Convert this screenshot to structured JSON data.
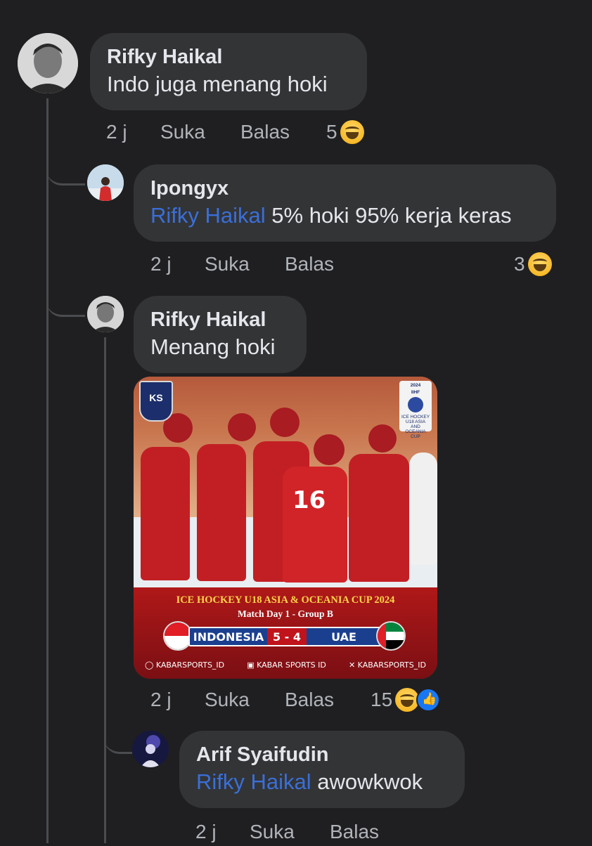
{
  "comments": [
    {
      "author": "Rifky Haikal",
      "text": "Indo juga menang hoki",
      "time": "2 j",
      "like_label": "Suka",
      "reply_label": "Balas",
      "reaction_count": "5",
      "reactions": [
        "laugh-emoji"
      ]
    },
    {
      "author": "Ipongyx",
      "mention": "Rifky Haikal",
      "text": "5% hoki 95% kerja keras",
      "time": "2 j",
      "like_label": "Suka",
      "reply_label": "Balas",
      "reaction_count": "3",
      "reactions": [
        "laugh-emoji"
      ]
    },
    {
      "author": "Rifky Haikal",
      "text": "Menang hoki",
      "time": "2 j",
      "like_label": "Suka",
      "reply_label": "Balas",
      "reaction_count": "15",
      "reactions": [
        "laugh-emoji",
        "like-emoji"
      ],
      "image": {
        "logo_left": "KS",
        "logo_right_year": "2024",
        "logo_right_org": "IIHF",
        "logo_right_text": "ICE HOCKEY U18 ASIA AND OCEANIA CUP",
        "jersey_number": "16",
        "headline": "ICE HOCKEY U18 ASIA & OCEANIA CUP 2024",
        "subheadline": "Match Day 1 - Group B",
        "team_a": "INDONESIA",
        "score": "5 - 4",
        "team_b": "UAE",
        "socials": [
          "KABARSPORTS_ID",
          "KABAR SPORTS ID",
          "KABARSPORTS_ID"
        ]
      }
    },
    {
      "author": "Arif Syaifudin",
      "mention": "Rifky Haikal",
      "text": "awowkwok",
      "time": "2 j",
      "like_label": "Suka",
      "reply_label": "Balas"
    }
  ],
  "colors": {
    "background": "#1f1f21",
    "bubble": "#333436",
    "mention": "#3a6fd8",
    "meta_text": "#b0b3b8"
  }
}
